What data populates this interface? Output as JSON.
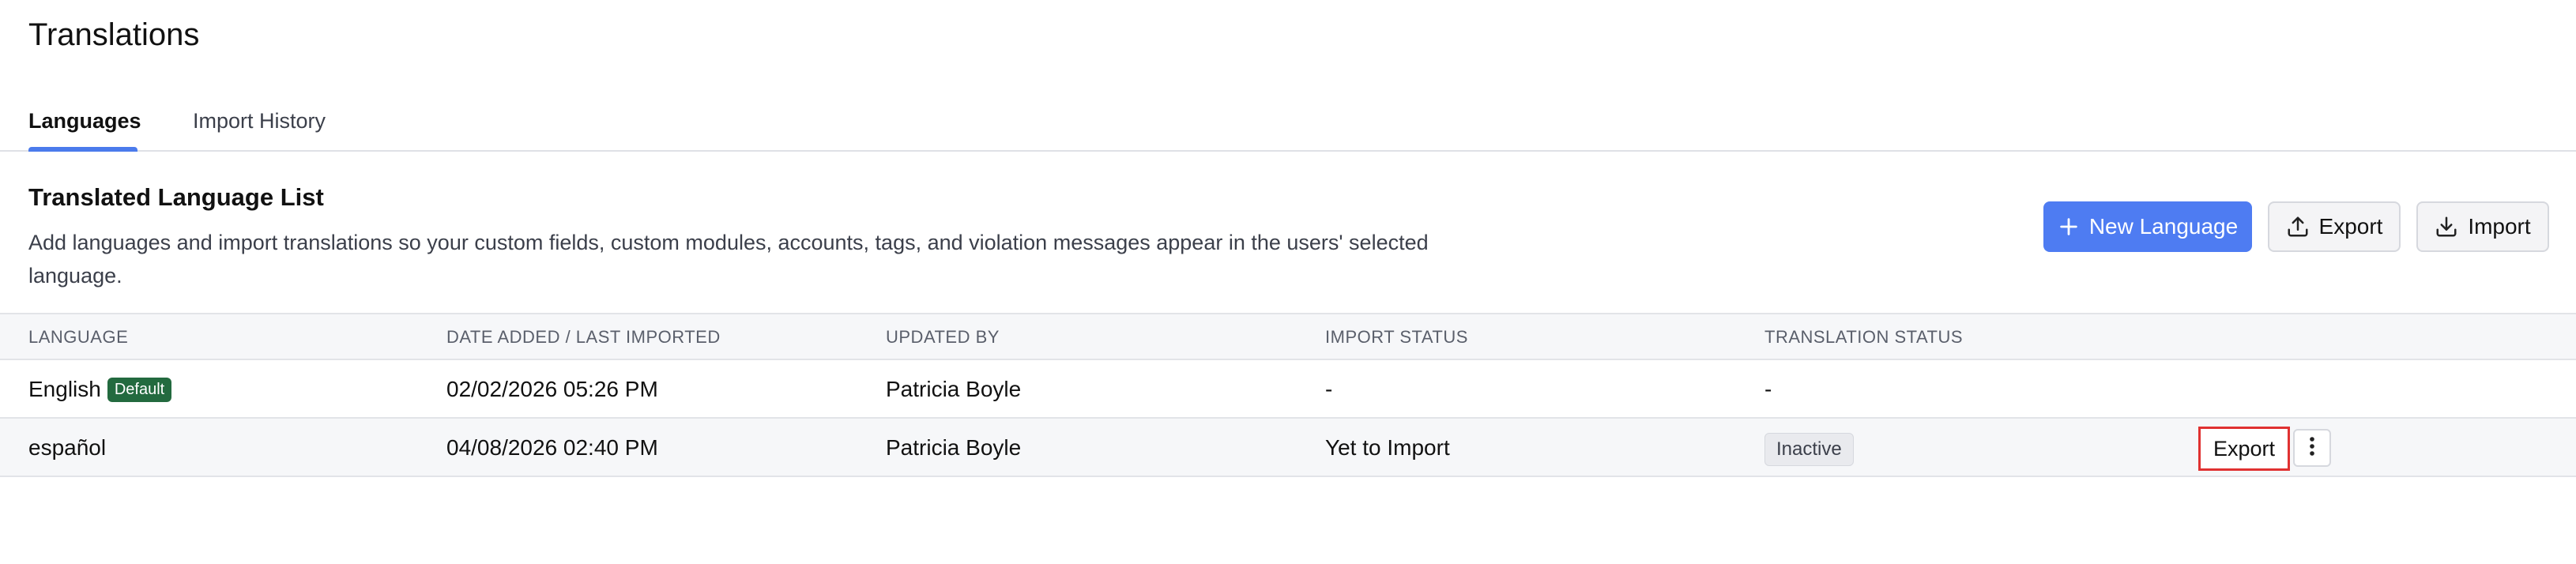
{
  "page": {
    "title": "Translations"
  },
  "tabs": [
    {
      "label": "Languages",
      "active": true
    },
    {
      "label": "Import History",
      "active": false
    }
  ],
  "section": {
    "title": "Translated Language List",
    "description": "Add languages and import translations so your custom fields, custom modules, accounts, tags, and violation messages appear in the users' selected language."
  },
  "actions": {
    "new_language": "New Language",
    "export": "Export",
    "import": "Import"
  },
  "table": {
    "headers": [
      "LANGUAGE",
      "DATE ADDED / LAST IMPORTED",
      "UPDATED BY",
      "IMPORT STATUS",
      "TRANSLATION STATUS"
    ],
    "rows": [
      {
        "language": "English",
        "badge": "Default",
        "date": "02/02/2026 05:26 PM",
        "updated_by": "Patricia Boyle",
        "import_status": "-",
        "translation_status": "-"
      },
      {
        "language": "español",
        "date": "04/08/2026 02:40 PM",
        "updated_by": "Patricia Boyle",
        "import_status": "Yet to Import",
        "translation_status": "Inactive",
        "export_label": "Export"
      }
    ]
  },
  "colors": {
    "primary": "#4e7cf2",
    "tab_indicator": "#4b7bec",
    "default_badge": "#236a3f",
    "highlight_border": "#e03131"
  },
  "icons": {
    "new_language": "plus-icon",
    "export": "upload-icon",
    "import": "download-icon",
    "row_menu": "more-vertical-icon"
  }
}
